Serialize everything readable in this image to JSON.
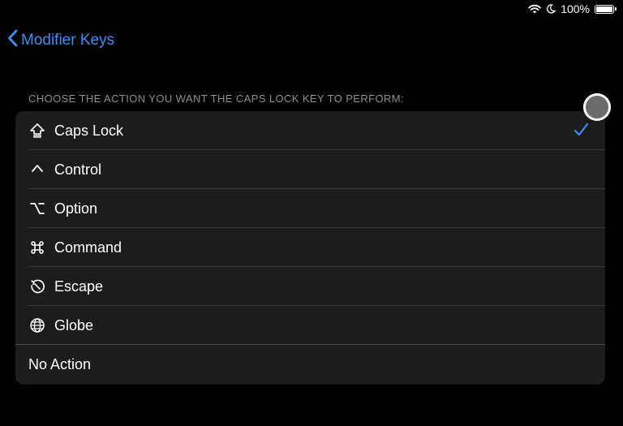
{
  "status_bar": {
    "battery_text": "100%",
    "icons": [
      "wifi-icon",
      "moon-icon",
      "battery-icon"
    ]
  },
  "nav": {
    "back_label": "Modifier Keys"
  },
  "section": {
    "header": "CHOOSE THE ACTION YOU WANT THE CAPS LOCK KEY TO PERFORM:"
  },
  "options": [
    {
      "label": "Caps Lock",
      "icon": "caps-lock-icon",
      "selected": true
    },
    {
      "label": "Control",
      "icon": "control-icon",
      "selected": false
    },
    {
      "label": "Option",
      "icon": "option-icon",
      "selected": false
    },
    {
      "label": "Command",
      "icon": "command-icon",
      "selected": false
    },
    {
      "label": "Escape",
      "icon": "escape-icon",
      "selected": false
    },
    {
      "label": "Globe",
      "icon": "globe-icon",
      "selected": false
    },
    {
      "label": "No Action",
      "icon": "",
      "selected": false
    }
  ],
  "colors": {
    "accent": "#3a8ef6",
    "background": "#000000",
    "cell": "#1c1c1e",
    "secondary_text": "#8d8d93"
  }
}
